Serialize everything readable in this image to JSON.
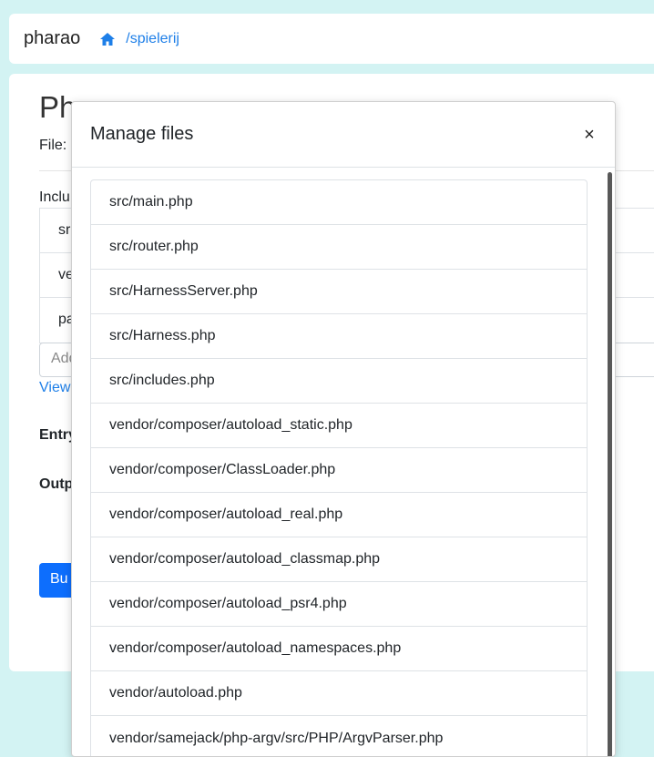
{
  "navbar": {
    "brand": "pharao",
    "breadcrumb_path": "/spielerij",
    "home_icon": "home-icon"
  },
  "background": {
    "title_partial": "Ph",
    "file_label_partial": "File:",
    "includes_label_partial": "Inclu",
    "include_items_partial": [
      "sr",
      "ve",
      "pa"
    ],
    "add_input_partial": "Add",
    "view_link_partial": "View",
    "entry_label_partial": "Entry",
    "output_label_partial": "Outp",
    "build_button_partial": "Bu"
  },
  "modal": {
    "title": "Manage files",
    "close_label": "×",
    "files": [
      "src/main.php",
      "src/router.php",
      "src/HarnessServer.php",
      "src/Harness.php",
      "src/includes.php",
      "vendor/composer/autoload_static.php",
      "vendor/composer/ClassLoader.php",
      "vendor/composer/autoload_real.php",
      "vendor/composer/autoload_classmap.php",
      "vendor/composer/autoload_psr4.php",
      "vendor/composer/autoload_namespaces.php",
      "vendor/autoload.php",
      "vendor/samejack/php-argv/src/PHP/ArgvParser.php"
    ]
  },
  "colors": {
    "page_background": "#d3f3f3",
    "link": "#1e7fe8",
    "primary_button": "#0d6efd"
  }
}
